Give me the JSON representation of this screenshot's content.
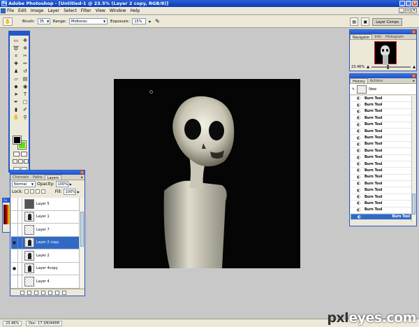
{
  "window": {
    "title": "Adobe Photoshop - [Untitled-1 @ 23.5% (Layer 2 copy, RGB/8)]"
  },
  "menu": [
    "File",
    "Edit",
    "Image",
    "Layer",
    "Select",
    "Filter",
    "View",
    "Window",
    "Help"
  ],
  "options": {
    "brush_label": "Brush:",
    "brush_size": "35",
    "range_label": "Range:",
    "range_value": "Midtones",
    "exposure_label": "Exposure:",
    "exposure_value": "15%",
    "layer_comps_label": "Layer Comps"
  },
  "layers_palette": {
    "tabs": [
      "Channels",
      "Paths",
      "Layers"
    ],
    "active_tab": "Layers",
    "blend_mode": "Normal",
    "opacity_label": "Opacity:",
    "opacity_value": "100%",
    "lock_label": "Lock:",
    "fill_label": "Fill:",
    "fill_value": "100%",
    "layers": [
      {
        "name": "Layer 5",
        "visible": false,
        "thumb": "dark"
      },
      {
        "name": "Layer 1",
        "visible": false,
        "thumb": "fig"
      },
      {
        "name": "Layer 7",
        "visible": false,
        "thumb": "checker"
      },
      {
        "name": "Layer 2 copy",
        "visible": true,
        "thumb": "fig",
        "selected": true
      },
      {
        "name": "Layer 2",
        "visible": false,
        "thumb": "fig"
      },
      {
        "name": "Layer 4copy",
        "visible": true,
        "thumb": "fig"
      },
      {
        "name": "Layer 4",
        "visible": false,
        "thumb": "checker"
      }
    ]
  },
  "navigator": {
    "tabs": [
      "Navigator",
      "Info",
      "Histogram"
    ],
    "active_tab": "Navigator",
    "zoom": "23.46%"
  },
  "history": {
    "tabs": [
      "History",
      "Actions"
    ],
    "active_tab": "History",
    "snapshot_label": "New",
    "items": [
      "Burn Tool",
      "Burn Tool",
      "Burn Tool",
      "Burn Tool",
      "Burn Tool",
      "Burn Tool",
      "Burn Tool",
      "Burn Tool",
      "Burn Tool",
      "Burn Tool",
      "Burn Tool",
      "Burn Tool",
      "Burn Tool",
      "Burn Tool",
      "Burn Tool",
      "Burn Tool",
      "Burn Tool",
      "Burn Tool",
      "Burn Tool"
    ],
    "selected_index": 18
  },
  "colors": {
    "foreground": "#000000",
    "background": "#66dd00",
    "titlebar": "#0a3cb4",
    "selection": "#316ac5"
  },
  "status": {
    "zoom": "23.46%",
    "doc": "Doc: 17.1M/445M"
  },
  "watermark": {
    "part1": "pxl",
    "part2": "eyes.com"
  }
}
